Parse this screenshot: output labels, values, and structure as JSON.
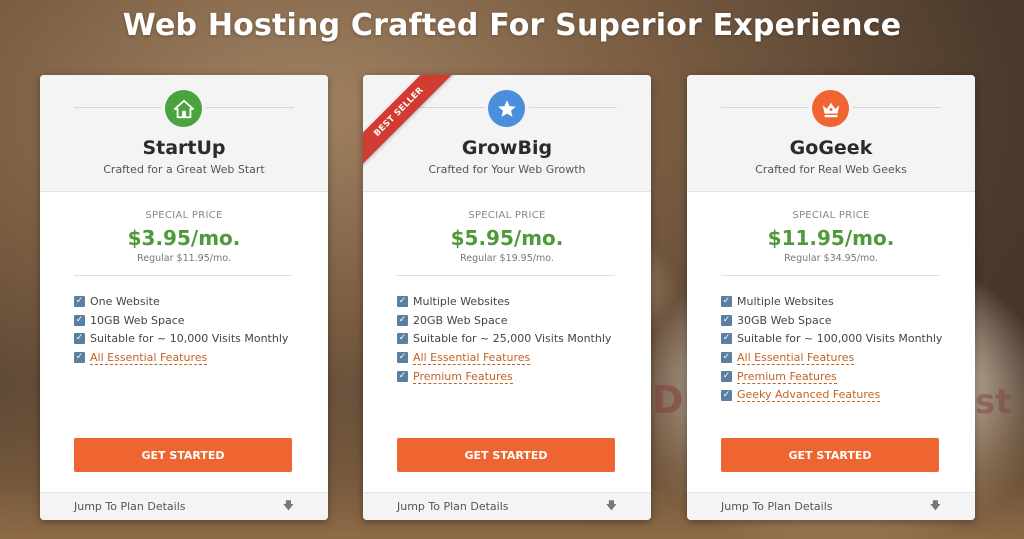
{
  "headline": "Web Hosting Crafted For Superior Experience",
  "colors": {
    "price_green": "#4e9a3b",
    "cta_orange": "#ee6531",
    "icon_green": "#4aa33e",
    "icon_blue": "#4a8edc",
    "icon_orange": "#ee6531",
    "ribbon_red": "#d23b2f",
    "checkbox_blue": "#5b7fa0",
    "link_orange": "#c06424"
  },
  "plans": [
    {
      "name": "StartUp",
      "tagline": "Crafted for a Great Web Start",
      "icon": "house-icon",
      "special_label": "SPECIAL PRICE",
      "price": "$3.95/mo.",
      "regular": "Regular $11.95/mo.",
      "features": [
        {
          "text": "One Website",
          "link": false
        },
        {
          "text": "10GB Web Space",
          "link": false
        },
        {
          "text": "Suitable for ~ 10,000 Visits Monthly",
          "link": false
        },
        {
          "text": "All Essential Features",
          "link": true
        }
      ],
      "cta": "GET STARTED",
      "jump": "Jump To Plan Details"
    },
    {
      "name": "GrowBig",
      "tagline": "Crafted for Your Web Growth",
      "icon": "star-icon",
      "badge": "BEST SELLER",
      "special_label": "SPECIAL PRICE",
      "price": "$5.95/mo.",
      "regular": "Regular $19.95/mo.",
      "features": [
        {
          "text": "Multiple Websites",
          "link": false
        },
        {
          "text": "20GB Web Space",
          "link": false
        },
        {
          "text": "Suitable for ~ 25,000 Visits Monthly",
          "link": false
        },
        {
          "text": "All Essential Features",
          "link": true
        },
        {
          "text": "Premium Features",
          "link": true
        }
      ],
      "cta": "GET STARTED",
      "jump": "Jump To Plan Details"
    },
    {
      "name": "GoGeek",
      "tagline": "Crafted for Real Web Geeks",
      "icon": "crown-icon",
      "special_label": "SPECIAL PRICE",
      "price": "$11.95/mo.",
      "regular": "Regular $34.95/mo.",
      "features": [
        {
          "text": "Multiple Websites",
          "link": false
        },
        {
          "text": "30GB Web Space",
          "link": false
        },
        {
          "text": "Suitable for ~ 100,000 Visits Monthly",
          "link": false
        },
        {
          "text": "All Essential Features",
          "link": true
        },
        {
          "text": "Premium Features",
          "link": true
        },
        {
          "text": "Geeky Advanced Features",
          "link": true
        }
      ],
      "cta": "GET STARTED",
      "jump": "Jump To Plan Details"
    }
  ]
}
